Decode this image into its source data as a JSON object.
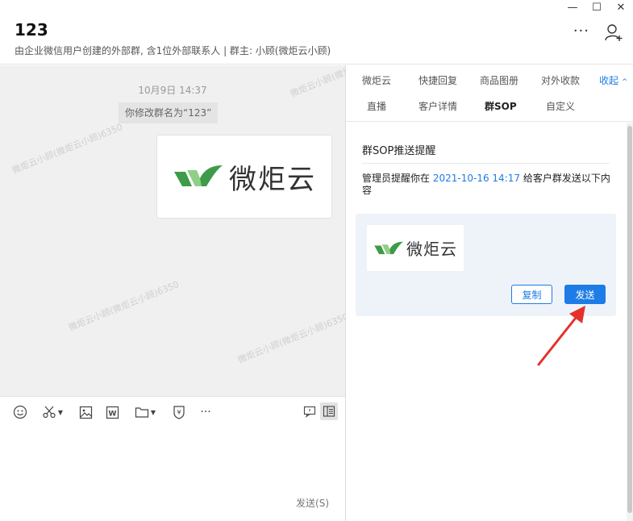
{
  "window": {
    "minimize": "—",
    "maximize": "☐",
    "close": "✕"
  },
  "header": {
    "title": "123",
    "subtitle": "由企业微信用户创建的外部群, 含1位外部联系人 | 群主: 小顾(微炬云小顾)",
    "more": "···",
    "add_user_icon": "add-user-icon"
  },
  "chat": {
    "timestamp": "10月9日 14:37",
    "notice": "你修改群名为“123”",
    "image_logo_text": "微炬云",
    "watermark": "微炬云小顾(微炬云小顾)6350"
  },
  "toolbar": {
    "icons": [
      "emoji-icon",
      "scissors-icon",
      "image-icon",
      "word-doc-icon",
      "folder-icon",
      "red-packet-icon",
      "more-icon"
    ],
    "more": "···",
    "send_label": "发送(S)"
  },
  "right_panel": {
    "tabs_row1": [
      "微炬云",
      "快捷回复",
      "商品图册",
      "对外收款"
    ],
    "collapse_label": "收起",
    "tabs_row2": [
      "直播",
      "客户详情",
      "群SOP",
      "自定义"
    ],
    "active_tab": "群SOP",
    "sop": {
      "title": "群SOP推送提醒",
      "desc_prefix": "管理员提醒你在",
      "date": "2021-10-16 14:17",
      "desc_suffix": "给客户群发送以下内容",
      "card_logo_text": "微炬云",
      "copy_label": "复制",
      "send_label": "发送"
    }
  },
  "colors": {
    "accent": "#1d7ce6",
    "logo_green_dark": "#3f9a4a",
    "logo_green_light": "#8fcf87",
    "arrow_red": "#e4312b"
  }
}
